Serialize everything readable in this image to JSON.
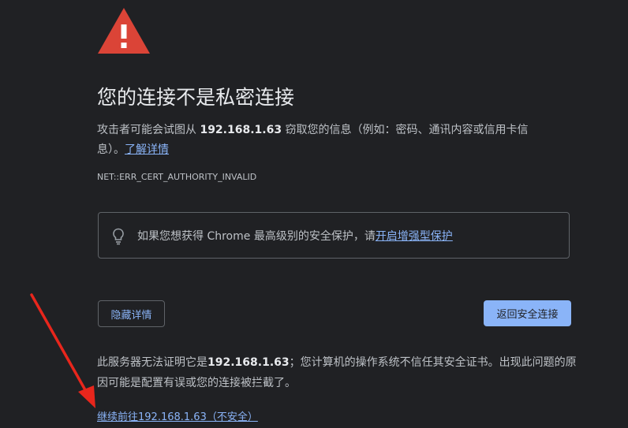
{
  "heading": "您的连接不是私密连接",
  "description": {
    "prefix": "攻击者可能会试图从 ",
    "host": "192.168.1.63",
    "suffix": " 窃取您的信息（例如：密码、通讯内容或信用卡信息）。",
    "learn_more": "了解详情"
  },
  "error_code": "NET::ERR_CERT_AUTHORITY_INVALID",
  "enhanced_protection": {
    "text": "如果您想获得 Chrome 最高级别的安全保护，请",
    "link": "开启增强型保护"
  },
  "buttons": {
    "details": "隐藏详情",
    "back": "返回安全连接"
  },
  "details": {
    "prefix": "此服务器无法证明它是",
    "host": "192.168.1.63",
    "suffix": "；您计算机的操作系统不信任其安全证书。出现此问题的原因可能是配置有误或您的连接被拦截了。",
    "proceed_link": "继续前往192.168.1.63（不安全）"
  },
  "colors": {
    "background": "#202124",
    "warning_red": "#db4437",
    "link_blue": "#8ab4f8",
    "annotation_arrow": "#e8261c"
  },
  "icons": {
    "warning": "warning-triangle-icon",
    "tip": "lightbulb-icon"
  }
}
